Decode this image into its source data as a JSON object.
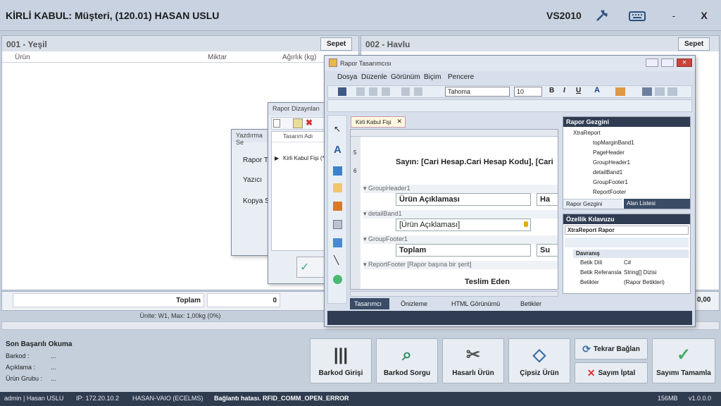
{
  "title": "KİRLİ KABUL: Müşteri, (120.01) HASAN USLU",
  "header": {
    "vs_label": "VS2010",
    "minimize": "-",
    "close": "X"
  },
  "left_panel": {
    "title": "001 - Yeşil",
    "sepet": "Sepet",
    "columns": [
      "Ürün",
      "Miktar",
      "Ağırlık (kg)"
    ],
    "total_label": "Toplam",
    "total_value": "0",
    "unit_info": "Ünite: W1, Max: 1,00kg (0%)"
  },
  "right_panel": {
    "title": "002 - Havlu",
    "sepet": "Sepet",
    "total_value": "0,00"
  },
  "print_dialog": {
    "title": "Yazdırma Se",
    "labels": [
      "Rapor T",
      "Yazıcı",
      "Kopya S"
    ]
  },
  "design_list": {
    "title": "Rapor Dizaynları",
    "column": "Tasarım Adı",
    "row": "Kirli Kabul Fişi (*)"
  },
  "designer": {
    "title": "Rapor Tasarımcısı",
    "menu": [
      "Dosya",
      "Düzenle",
      "Görünüm",
      "Biçim",
      "Pencere"
    ],
    "font_name": "Tahoma",
    "font_size": "10",
    "tab": "Kirli Kabul Fişi",
    "line_numbers": [
      "5",
      "6"
    ],
    "report_text_1": "Sayın: [Cari Hesap.Cari Hesap Kodu], [Cari",
    "bands": {
      "group_header": "GroupHeader1",
      "detail": "detailBand1",
      "group_footer": "GroupFooter1",
      "report_footer": "ReportFooter [Rapor başına bir şerit]"
    },
    "cells": {
      "urun_aciklamasi": "Ürün Açıklaması",
      "ha": "Ha",
      "urun_field": "[Ürün Açıklaması]",
      "toplam": "Toplam",
      "su": "Su",
      "teslim": "Teslim Eden"
    },
    "bottom_tabs": [
      "Tasarımcı",
      "Önizleme",
      "HTML Görünümü",
      "Betikler"
    ],
    "explorer": {
      "title": "Rapor Gezgini",
      "items": [
        "XtraReport",
        "topMarginBand1",
        "PageHeader",
        "GroupHeader1",
        "detailBand1",
        "GroupFooter1",
        "ReportFooter"
      ],
      "tabs": [
        "Rapor Gezgini",
        "Alan Listesi"
      ]
    },
    "properties": {
      "title": "Özellik Kılavuzu",
      "selector": "XtraReport  Rapor",
      "category": "Davranış",
      "rows": [
        {
          "name": "Betik Dili",
          "value": "C#"
        },
        {
          "name": "Betik Referansla",
          "value": "String[] Dizisi"
        },
        {
          "name": "Betikler",
          "value": "(Rapor Betikleri)"
        }
      ]
    }
  },
  "last_read": {
    "title": "Son Başarılı Okuma",
    "rows": [
      {
        "label": "Barkod :",
        "value": "..."
      },
      {
        "label": "Açıklama :",
        "value": "..."
      },
      {
        "label": "Ürün Grubu :",
        "value": "..."
      }
    ]
  },
  "actions": {
    "barkod_giris": "Barkod Girişi",
    "barkod_sorgu": "Barkod Sorgu",
    "hasarli": "Hasarlı Ürün",
    "cipsiz": "Çipsiz Ürün",
    "tekrar": "Tekrar Bağlan",
    "iptal": "Sayım İptal",
    "tamamla": "Sayımı Tamamla"
  },
  "status": {
    "user": "admin | Hasan USLU",
    "ip": "IP: 172.20.10.2",
    "host": "HASAN-VAIO (ECELMS)",
    "error": "Bağlantı hatası. RFID_COMM_OPEN_ERROR",
    "memory": "156MB",
    "version": "v1.0.0.0"
  }
}
